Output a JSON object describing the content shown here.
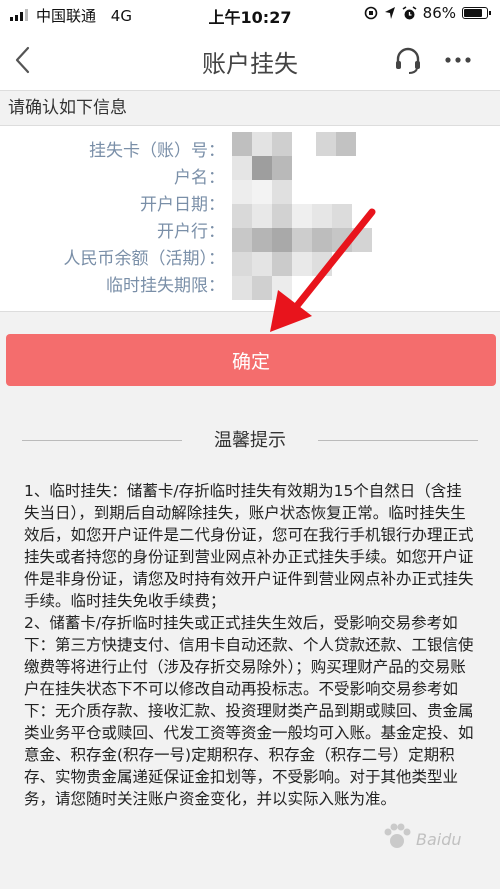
{
  "status_bar": {
    "carrier": "中国联通",
    "network": "4G",
    "time": "上午10:27",
    "battery_text": "86%",
    "battery_level": 0.86
  },
  "nav": {
    "title": "账户挂失"
  },
  "confirm_hint": "请确认如下信息",
  "info": {
    "rows": [
      {
        "label": "挂失卡（账）号："
      },
      {
        "label": "户名："
      },
      {
        "label": "开户日期："
      },
      {
        "label": "开户行："
      },
      {
        "label": "人民币余额（活期）："
      },
      {
        "label": "临时挂失期限："
      }
    ]
  },
  "confirm_button": "确定",
  "tips": {
    "title": "温馨提示",
    "paragraphs": [
      "1、临时挂失：储蓄卡/存折临时挂失有效期为15个自然日（含挂失当日），到期后自动解除挂失，账户状态恢复正常。临时挂失生效后，如您开户证件是二代身份证，您可在我行手机银行办理正式挂失或者持您的身份证到营业网点补办正式挂失手续。如您开户证件是非身份证，请您及时持有效开户证件到营业网点补办正式挂失手续。临时挂失免收手续费；",
      "2、储蓄卡/存折临时挂失或正式挂失生效后，受影响交易参考如下：第三方快捷支付、信用卡自动还款、个人贷款还款、工银信使缴费等将进行止付（涉及存折交易除外）；购买理财产品的交易账户在挂失状态下不可以修改自动再投标志。不受影响交易参考如下：无介质存款、接收汇款、投资理财类产品到期或赎回、贵金属类业务平仓或赎回、代发工资等资金一般均可入账。基金定投、如意金、积存金(积存一号)定期积存、积存金（积存二号）定期积存、实物贵金属递延保证金扣划等，不受影响。对于其他类型业务，请您随时关注账户资金变化，并以实际入账为准。"
    ]
  },
  "colors": {
    "primary_button": "#f46d6d",
    "label_text": "#7a8fa8",
    "arrow": "#e8141c"
  }
}
